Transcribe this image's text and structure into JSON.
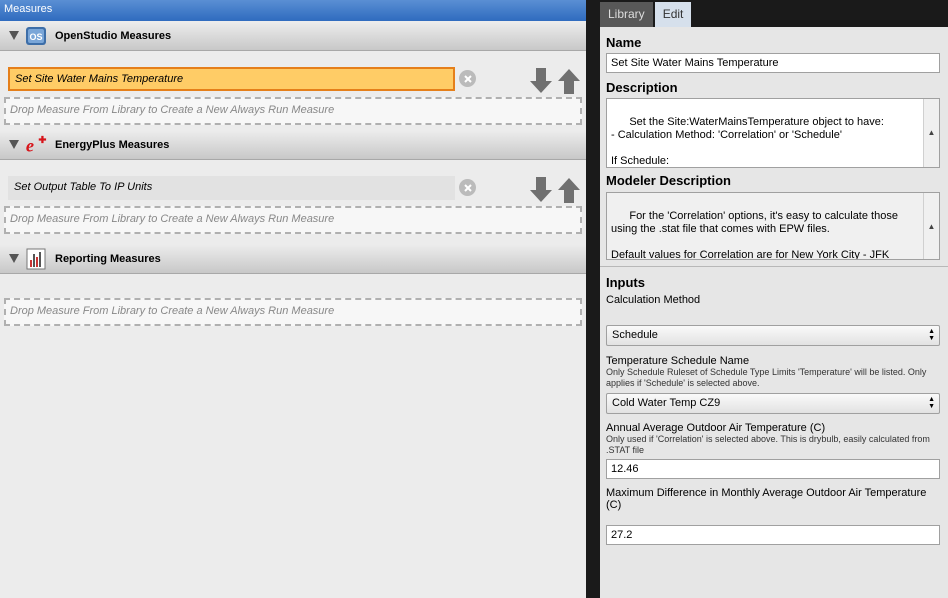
{
  "left": {
    "title": "Measures",
    "groups": [
      {
        "title": "OpenStudio Measures",
        "measure": "Set Site Water Mains Temperature",
        "drop": "Drop Measure From Library to Create a New Always Run Measure"
      },
      {
        "title": "EnergyPlus Measures",
        "measure": "Set Output Table To IP Units",
        "drop": "Drop Measure From Library to Create a New Always Run Measure"
      },
      {
        "title": "Reporting Measures",
        "drop": "Drop Measure From Library to Create a New Always Run Measure"
      }
    ]
  },
  "right": {
    "tabs": [
      "Library",
      "Edit"
    ],
    "name_label": "Name",
    "name_value": "Set Site Water Mains Temperature",
    "description_label": "Description",
    "description_text": "Set the Site:WaterMainsTemperature object to have:\n- Calculation Method: 'Correlation' or 'Schedule'\n\nIf Schedule:\n- user-supplied schedule",
    "modeler_label": "Modeler Description",
    "modeler_text": "For the 'Correlation' options, it's easy to calculate those using the .stat file that comes with EPW files.\n\nDefault values for Correlation are for New York City - JFK Airport.",
    "inputs_label": "Inputs",
    "calc_method_label": "Calculation Method",
    "calc_method_value": "Schedule",
    "temp_sched_label": "Temperature Schedule Name",
    "temp_sched_hint": "Only Schedule Ruleset of Schedule Type Limits 'Temperature' will be listed. Only applies if 'Schedule' is selected above.",
    "temp_sched_value": "Cold Water Temp CZ9",
    "annual_label": "Annual Average Outdoor Air Temperature (C)",
    "annual_hint": "Only used if 'Correlation' is selected above. This is drybulb, easily calculated from .STAT file",
    "annual_value": "12.46",
    "maxdiff_label": "Maximum Difference in Monthly Average Outdoor Air Temperature (C)",
    "maxdiff_value": "27.2"
  },
  "colors": {
    "selected_fill": "#ffcc66",
    "selected_border": "#e57f1a",
    "title_bar": "#2f6bbf",
    "energyplus_red": "#d7141a"
  }
}
